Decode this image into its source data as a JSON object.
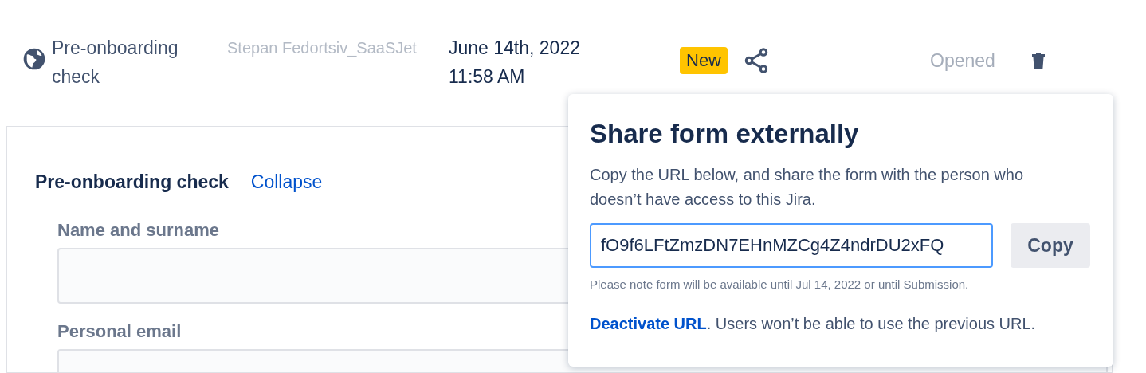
{
  "row": {
    "title": "Pre-onboarding check",
    "user": "Stepan Fedortsiv_SaaSJet",
    "date": "June 14th, 2022",
    "time": "11:58 AM",
    "badge": "New",
    "status": "Opened"
  },
  "form": {
    "title": "Pre-onboarding check",
    "collapse_link": "Collapse",
    "fields": [
      {
        "label": "Name and surname"
      },
      {
        "label": "Personal email"
      }
    ]
  },
  "popover": {
    "title": "Share form externally",
    "description": "Copy the URL below, and share the form with the person who doesn’t have access to this Jira.",
    "url": "fO9f6LFtZmzDN7EHnMZCg4Z4ndrDU2xFQ",
    "copy_button": "Copy",
    "note": "Please note form will be available until Jul 14, 2022 or until Submission.",
    "deactivate_link": "Deactivate URL",
    "deactivate_text": ". Users won’t be able to use the previous URL."
  }
}
